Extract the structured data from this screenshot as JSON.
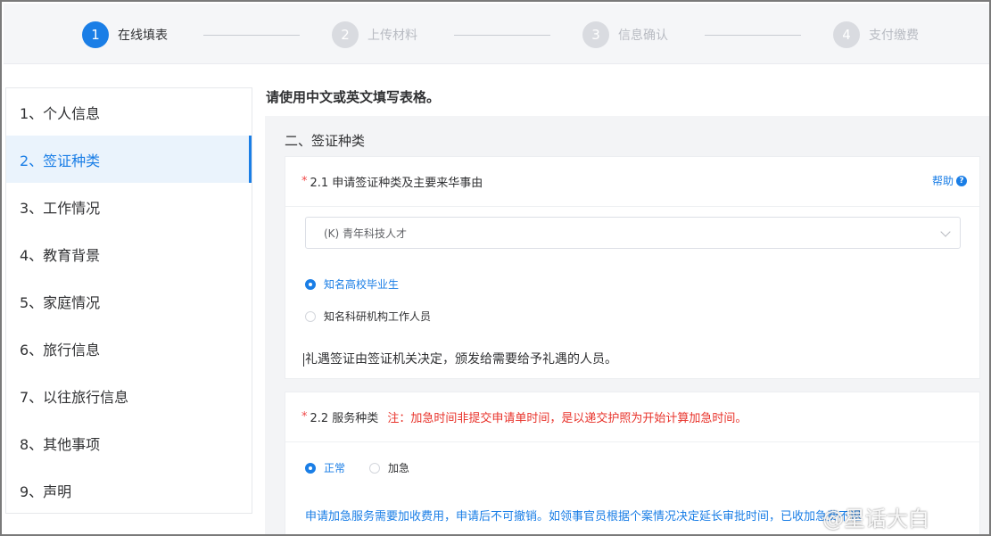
{
  "steps": [
    {
      "num": "1",
      "label": "在线填表"
    },
    {
      "num": "2",
      "label": "上传材料"
    },
    {
      "num": "3",
      "label": "信息确认"
    },
    {
      "num": "4",
      "label": "支付缴费"
    }
  ],
  "sidebar": {
    "items": [
      {
        "label": "1、个人信息"
      },
      {
        "label": "2、签证种类"
      },
      {
        "label": "3、工作情况"
      },
      {
        "label": "4、教育背景"
      },
      {
        "label": "5、家庭情况"
      },
      {
        "label": "6、旅行信息"
      },
      {
        "label": "7、以往旅行信息"
      },
      {
        "label": "8、其他事项"
      },
      {
        "label": "9、声明"
      }
    ]
  },
  "main": {
    "intro": "请使用中文或英文填写表格。",
    "section_title": "二、签证种类",
    "q1": {
      "required_mark": "*",
      "title": "2.1 申请签证种类及主要来华事由",
      "help": "帮助",
      "help_icon": "?",
      "select_value": "(K) 青年科技人才",
      "options": [
        "知名高校毕业生",
        "知名科研机构工作人员"
      ],
      "selected": "知名高校毕业生",
      "description": "礼遇签证由签证机关决定，颁发给需要给予礼遇的人员。"
    },
    "q2": {
      "required_mark": "*",
      "title": "2.2 服务种类",
      "note": "注：加急时间非提交申请单时间，是以递交护照为开始计算加急时间。",
      "options": [
        "正常",
        "加急"
      ],
      "selected": "正常",
      "warning": "申请加急服务需要加收费用，申请后不可撤销。如领事官员根据个案情况决定延长审批时间，已收加急费不退"
    }
  },
  "watermark": "@星话大白",
  "colors": {
    "accent": "#1a7ee6",
    "note_red": "#e8332b",
    "required": "#f04848"
  }
}
